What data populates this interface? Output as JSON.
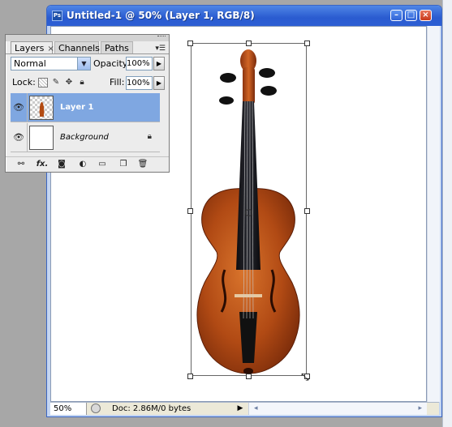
{
  "document": {
    "title": "Untitled-1 @ 50% (Layer 1, RGB/8)",
    "app_icon": "Ps",
    "window_buttons": [
      "minimize",
      "maximize",
      "close"
    ],
    "status": {
      "zoom": "50%",
      "doc_info": "Doc: 2.86M/0 bytes"
    }
  },
  "layers_panel": {
    "tabs": [
      {
        "label": "Layers",
        "close": "×"
      },
      {
        "label": "Channels"
      },
      {
        "label": "Paths"
      }
    ],
    "blend_mode": "Normal",
    "opacity_label": "Opacity:",
    "opacity_value": "100%",
    "lock_label": "Lock:",
    "fill_label": "Fill:",
    "fill_value": "100%",
    "layers": [
      {
        "name": "Layer 1",
        "selected": true
      },
      {
        "name": "Background",
        "selected": false,
        "locked": true
      }
    ],
    "bottom_tools": [
      "link-icon",
      "fx-icon",
      "mask-icon",
      "adjustment-icon",
      "folder-icon",
      "new-layer-icon",
      "trash-icon"
    ],
    "fx_label": "fx."
  },
  "colors": {
    "title_bar": "#2a5bd0",
    "selected_layer": "#7fa7e1",
    "violin_body": "#b14a14"
  }
}
